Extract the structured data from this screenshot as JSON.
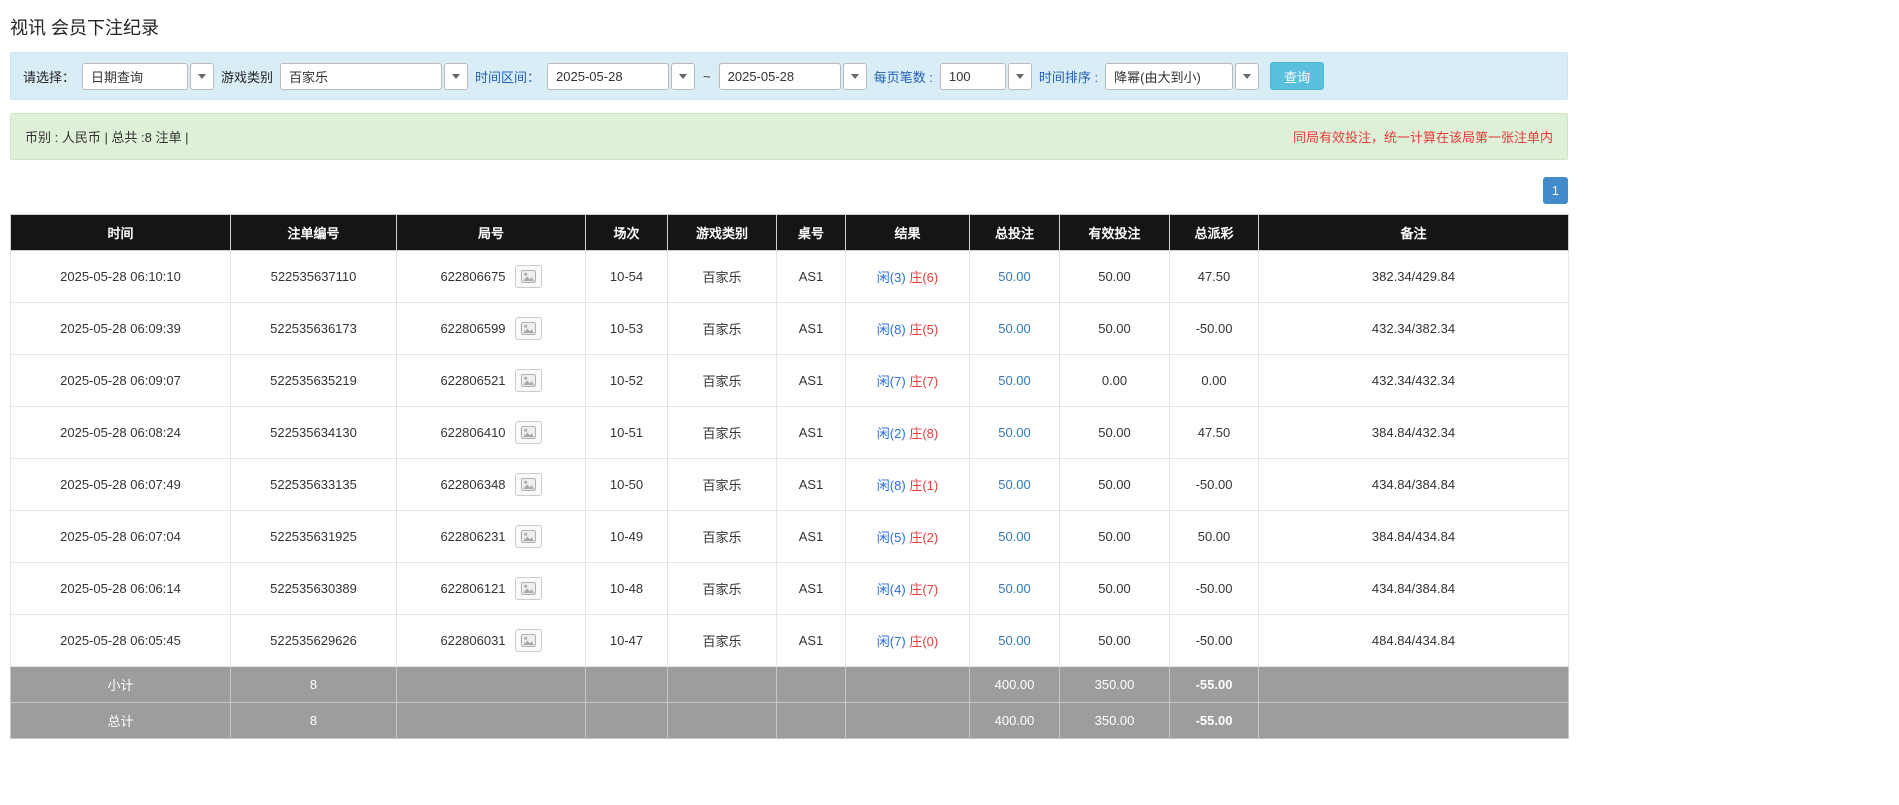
{
  "page": {
    "title": "视讯 会员下注纪录"
  },
  "filters": {
    "select_label": "请选择：",
    "select_value": "日期查询",
    "game_type_label": "游戏类别",
    "game_type_value": "百家乐",
    "date_range_label": "时间区间：",
    "date_from": "2025-05-28",
    "date_separator": "~",
    "date_to": "2025-05-28",
    "page_size_label": "每页笔数 :",
    "page_size_value": "100",
    "sort_label": "时间排序 :",
    "sort_value": "降幂(由大到小)",
    "search_button": "查询"
  },
  "summary": {
    "left": "币别 : 人民币 | 总共 :8 注单 |",
    "notice": "同局有效投注，统一计算在该局第一张注单内"
  },
  "pagination": {
    "current": "1"
  },
  "icons": {
    "combo_dropdown": "chevron-down",
    "round_result": "image-icon"
  },
  "colors": {
    "header_bg": "#151515",
    "footer_bg": "#9d9d9d",
    "filter_bg": "#d9edf7",
    "summary_bg": "#dff0d8",
    "accent_blue": "#428bca",
    "search_btn": "#5bc0de",
    "player_blue": "#2a6fdb",
    "banker_red": "#e53c3c",
    "negative_red": "#ff0000",
    "link_blue": "#337ab7"
  },
  "table": {
    "headers": [
      "时间",
      "注单编号",
      "局号",
      "场次",
      "游戏类别",
      "桌号",
      "结果",
      "总投注",
      "有效投注",
      "总派彩",
      "备注"
    ],
    "rows": [
      {
        "time": "2025-05-28 06:10:10",
        "bet_id": "522535637110",
        "round_id": "622806675",
        "session": "10-54",
        "game_type": "百家乐",
        "table_no": "AS1",
        "result_player": "闲(3)",
        "result_banker": "庄(6)",
        "total_bet": "50.00",
        "valid_bet": "50.00",
        "payout": "47.50",
        "remark": "382.34/429.84"
      },
      {
        "time": "2025-05-28 06:09:39",
        "bet_id": "522535636173",
        "round_id": "622806599",
        "session": "10-53",
        "game_type": "百家乐",
        "table_no": "AS1",
        "result_player": "闲(8)",
        "result_banker": "庄(5)",
        "total_bet": "50.00",
        "valid_bet": "50.00",
        "payout": "-50.00",
        "remark": "432.34/382.34"
      },
      {
        "time": "2025-05-28 06:09:07",
        "bet_id": "522535635219",
        "round_id": "622806521",
        "session": "10-52",
        "game_type": "百家乐",
        "table_no": "AS1",
        "result_player": "闲(7)",
        "result_banker": "庄(7)",
        "total_bet": "50.00",
        "valid_bet": "0.00",
        "payout": "0.00",
        "remark": "432.34/432.34"
      },
      {
        "time": "2025-05-28 06:08:24",
        "bet_id": "522535634130",
        "round_id": "622806410",
        "session": "10-51",
        "game_type": "百家乐",
        "table_no": "AS1",
        "result_player": "闲(2)",
        "result_banker": "庄(8)",
        "total_bet": "50.00",
        "valid_bet": "50.00",
        "payout": "47.50",
        "remark": "384.84/432.34"
      },
      {
        "time": "2025-05-28 06:07:49",
        "bet_id": "522535633135",
        "round_id": "622806348",
        "session": "10-50",
        "game_type": "百家乐",
        "table_no": "AS1",
        "result_player": "闲(8)",
        "result_banker": "庄(1)",
        "total_bet": "50.00",
        "valid_bet": "50.00",
        "payout": "-50.00",
        "remark": "434.84/384.84"
      },
      {
        "time": "2025-05-28 06:07:04",
        "bet_id": "522535631925",
        "round_id": "622806231",
        "session": "10-49",
        "game_type": "百家乐",
        "table_no": "AS1",
        "result_player": "闲(5)",
        "result_banker": "庄(2)",
        "total_bet": "50.00",
        "valid_bet": "50.00",
        "payout": "50.00",
        "remark": "384.84/434.84"
      },
      {
        "time": "2025-05-28 06:06:14",
        "bet_id": "522535630389",
        "round_id": "622806121",
        "session": "10-48",
        "game_type": "百家乐",
        "table_no": "AS1",
        "result_player": "闲(4)",
        "result_banker": "庄(7)",
        "total_bet": "50.00",
        "valid_bet": "50.00",
        "payout": "-50.00",
        "remark": "434.84/384.84"
      },
      {
        "time": "2025-05-28 06:05:45",
        "bet_id": "522535629626",
        "round_id": "622806031",
        "session": "10-47",
        "game_type": "百家乐",
        "table_no": "AS1",
        "result_player": "闲(7)",
        "result_banker": "庄(0)",
        "total_bet": "50.00",
        "valid_bet": "50.00",
        "payout": "-50.00",
        "remark": "484.84/434.84"
      }
    ],
    "footer": [
      {
        "label": "小计",
        "count": "8",
        "total_bet": "400.00",
        "valid_bet": "350.00",
        "payout": "-55.00"
      },
      {
        "label": "总计",
        "count": "8",
        "total_bet": "400.00",
        "valid_bet": "350.00",
        "payout": "-55.00"
      }
    ]
  }
}
